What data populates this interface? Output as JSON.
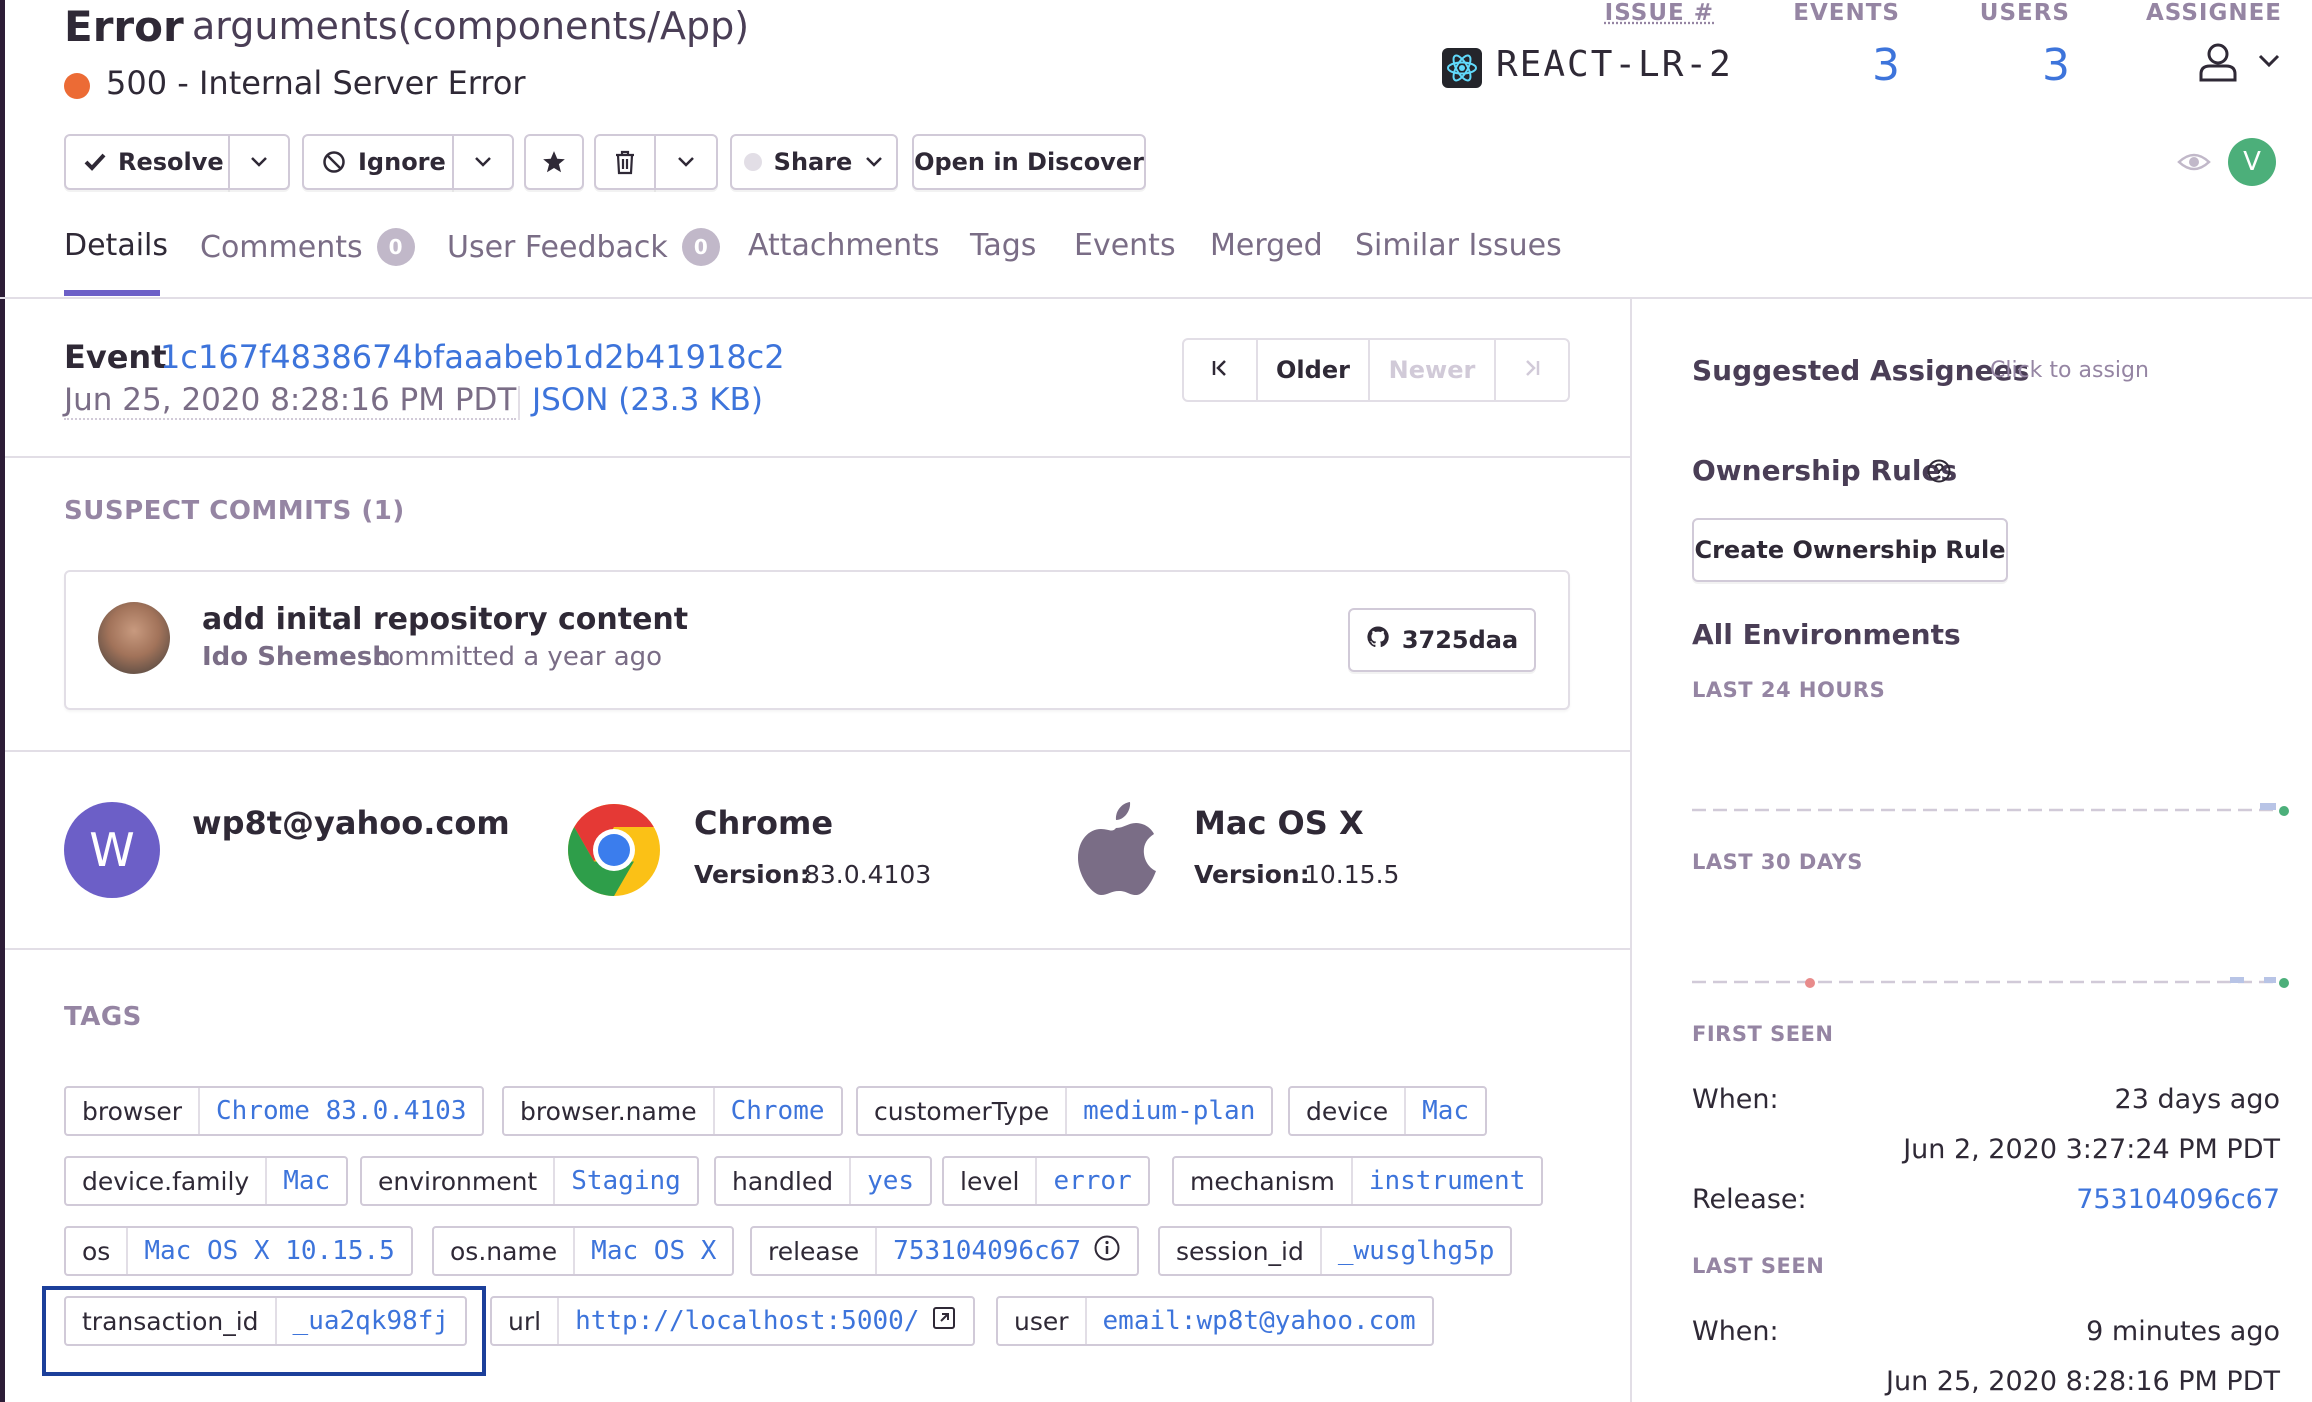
{
  "issue": {
    "type": "Error",
    "title": "arguments(components/App)",
    "message": "500 - Internal Server Error",
    "level_color": "#ec6b35"
  },
  "stats": {
    "issue_label": "ISSUE #",
    "issue_id": "REACT-LR-2",
    "issue_icon": "react-icon",
    "events_label": "EVENTS",
    "events": "3",
    "users_label": "USERS",
    "users": "3",
    "assignee_label": "ASSIGNEE"
  },
  "actions": {
    "resolve": "Resolve",
    "ignore": "Ignore",
    "share": "Share",
    "open_discover": "Open in Discover"
  },
  "participant_initial": "V",
  "tabs": [
    {
      "label": "Details",
      "active": true
    },
    {
      "label": "Comments",
      "badge": "0"
    },
    {
      "label": "User Feedback",
      "badge": "0"
    },
    {
      "label": "Attachments"
    },
    {
      "label": "Tags"
    },
    {
      "label": "Events"
    },
    {
      "label": "Merged"
    },
    {
      "label": "Similar Issues"
    }
  ],
  "event": {
    "label": "Event",
    "id": "1c167f4838674bfaaabeb1d2b41918c2",
    "date": "Jun 25, 2020 8:28:16 PM PDT",
    "json_link": "JSON (23.3 KB)",
    "pager": {
      "older": "Older",
      "newer": "Newer"
    }
  },
  "suspect_commits": {
    "title": "SUSPECT COMMITS (1)",
    "message": "add inital repository content",
    "author": "Ido Shemesh",
    "when": "committed a year ago",
    "hash": "3725daa"
  },
  "context": {
    "user_initial": "W",
    "user_email": "wp8t@yahoo.com",
    "browser_name": "Chrome",
    "browser_version_label": "Version:",
    "browser_version": "83.0.4103",
    "os_name": "Mac OS X",
    "os_version_label": "Version:",
    "os_version": "10.15.5"
  },
  "tags": {
    "title": "TAGS",
    "items": [
      {
        "key": "browser",
        "value": "Chrome 83.0.4103"
      },
      {
        "key": "browser.name",
        "value": "Chrome"
      },
      {
        "key": "customerType",
        "value": "medium-plan"
      },
      {
        "key": "device",
        "value": "Mac"
      },
      {
        "key": "device.family",
        "value": "Mac"
      },
      {
        "key": "environment",
        "value": "Staging"
      },
      {
        "key": "handled",
        "value": "yes"
      },
      {
        "key": "level",
        "value": "error"
      },
      {
        "key": "mechanism",
        "value": "instrument"
      },
      {
        "key": "os",
        "value": "Mac OS X 10.15.5"
      },
      {
        "key": "os.name",
        "value": "Mac OS X"
      },
      {
        "key": "release",
        "value": "753104096c67"
      },
      {
        "key": "session_id",
        "value": "_wusglhg5p"
      },
      {
        "key": "transaction_id",
        "value": "_ua2qk98fj"
      },
      {
        "key": "url",
        "value": "http://localhost:5000/"
      },
      {
        "key": "user",
        "value": "email:wp8t@yahoo.com"
      }
    ]
  },
  "sidebar": {
    "suggested_assignees": "Suggested Assignees",
    "click_to_assign": "Click to assign",
    "ownership_rules": "Ownership Rules",
    "create_rule": "Create Ownership Rule",
    "all_environments": "All Environments",
    "last_24h": "LAST 24 HOURS",
    "last_30d": "LAST 30 DAYS",
    "first_seen": {
      "title": "FIRST SEEN",
      "when_label": "When:",
      "relative": "23 days ago",
      "absolute": "Jun 2, 2020 3:27:24 PM PDT",
      "release_label": "Release:",
      "release": "753104096c67"
    },
    "last_seen": {
      "title": "LAST SEEN",
      "when_label": "When:",
      "relative": "9 minutes ago",
      "absolute": "Jun 25, 2020 8:28:16 PM PDT"
    }
  }
}
